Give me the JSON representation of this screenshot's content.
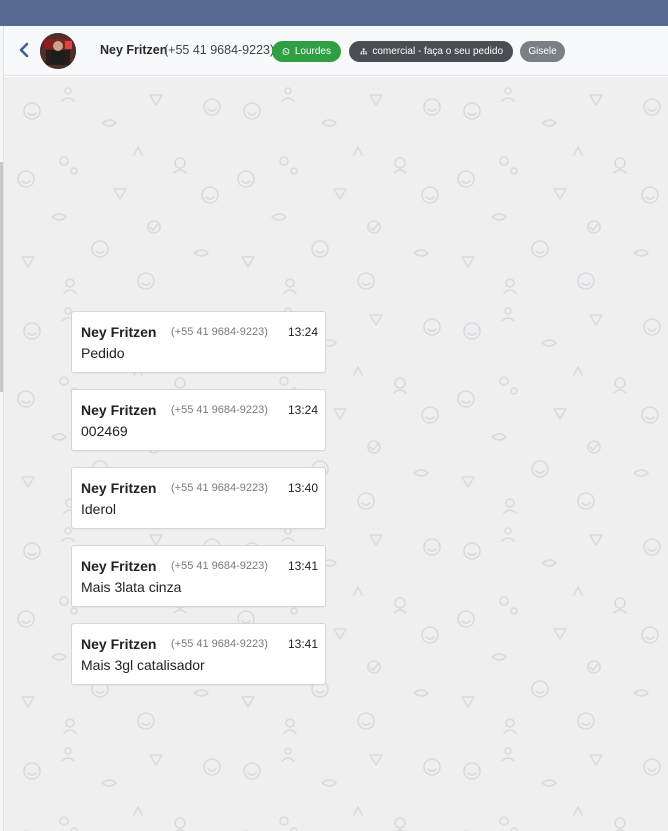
{
  "header": {
    "contact_name": "Ney Fritzen",
    "contact_phone": "(+55 41 9684-9223)",
    "tags": [
      {
        "label": "Lourdes",
        "icon": "whatsapp-icon",
        "color": "#2ea043"
      },
      {
        "label": "comercial - faça o seu pedido",
        "icon": "sitemap-icon",
        "color": "#4a4d52"
      },
      {
        "label": "Gisele",
        "color": "#7a7f86"
      }
    ]
  },
  "messages": [
    {
      "sender": "Ney Fritzen",
      "phone": "(+55 41 9684-9223)",
      "time": "13:24",
      "text": "Pedido"
    },
    {
      "sender": "Ney Fritzen",
      "phone": "(+55 41 9684-9223)",
      "time": "13:24",
      "text": "002469"
    },
    {
      "sender": "Ney Fritzen",
      "phone": "(+55 41 9684-9223)",
      "time": "13:40",
      "text": "Iderol"
    },
    {
      "sender": "Ney Fritzen",
      "phone": "(+55 41 9684-9223)",
      "time": "13:41",
      "text": "Mais 3lata cinza"
    },
    {
      "sender": "Ney Fritzen",
      "phone": "(+55 41 9684-9223)",
      "time": "13:41",
      "text": "Mais 3gl catalisador"
    }
  ],
  "colors": {
    "topbar": "#566a93",
    "chat_background": "#efefef",
    "pattern": "#dcdee4"
  }
}
